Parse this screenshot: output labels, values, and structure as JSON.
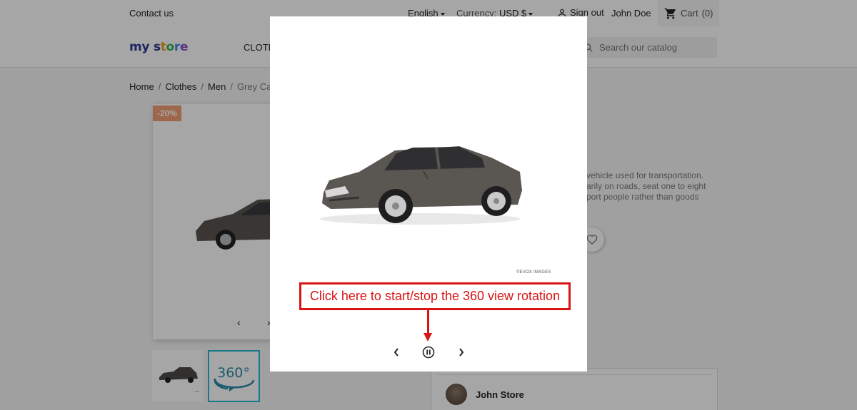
{
  "topbar": {
    "contact": "Contact us",
    "language": "English",
    "currency_label": "Currency:",
    "currency_value": "USD $",
    "signout": "Sign out",
    "user": "John Doe",
    "cart": "Cart",
    "cart_count": "(0)"
  },
  "header": {
    "logo": [
      "my",
      "store"
    ],
    "nav_item": "Clothes",
    "search_placeholder": "Search our catalog"
  },
  "breadcrumb": {
    "items": [
      "Home",
      "Clothes",
      "Men"
    ],
    "current": "Grey Ca",
    "separator": "/"
  },
  "product": {
    "discount": "-20%",
    "description_lines": [
      "vehicle used for transportation.",
      "arily on roads, seat one to eight",
      "port people rather than goods"
    ],
    "thumb2_label": "360°"
  },
  "seller": {
    "name": "John Store"
  },
  "modal": {
    "credit": "©EVOX IMAGES",
    "callout": "Click here to start/stop the 360 view rotation"
  },
  "colors": {
    "accent": "#24b9d7",
    "callout_red": "#d91414",
    "discount": "#f39d72"
  }
}
